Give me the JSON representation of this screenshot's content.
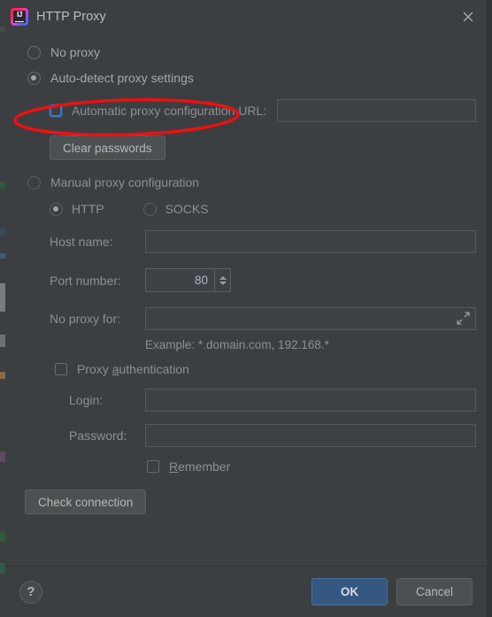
{
  "window": {
    "title": "HTTP Proxy",
    "app_icon": "intellij-idea-icon",
    "close_icon": "close-icon"
  },
  "proxy_mode": {
    "selected": "auto-detect",
    "options": [
      {
        "id": "no-proxy",
        "label": "No proxy",
        "checked": false
      },
      {
        "id": "auto-detect",
        "label": "Auto-detect proxy settings",
        "checked": true
      },
      {
        "id": "manual",
        "label": "Manual proxy configuration",
        "checked": false
      }
    ]
  },
  "auto_section": {
    "pac_checkbox_label": "Automatic proxy configuration URL:",
    "pac_checked": false,
    "pac_url_value": "",
    "clear_passwords_label": "Clear passwords"
  },
  "manual_section": {
    "protocol": {
      "selected": "HTTP",
      "options": [
        {
          "id": "http",
          "label": "HTTP",
          "checked": true
        },
        {
          "id": "socks",
          "label": "SOCKS",
          "checked": false
        }
      ]
    },
    "host_name_label": "Host name:",
    "host_name_value": "",
    "port_number_label": "Port number:",
    "port_number_value": "80",
    "no_proxy_for_label": "No proxy for:",
    "no_proxy_for_value": "",
    "expand_icon": "expand-arrows-icon",
    "example_text": "Example: *.domain.com, 192.168.*",
    "proxy_auth_label": "Proxy authentication",
    "proxy_auth_mnemonic": "a",
    "proxy_auth_checked": false,
    "login_label": "Login:",
    "login_value": "",
    "password_label": "Password:",
    "password_value": "",
    "remember_label": "Remember",
    "remember_mnemonic": "R",
    "remember_checked": false
  },
  "check_connection_label": "Check connection",
  "footer": {
    "help_icon": "question-mark-icon",
    "ok_label": "OK",
    "cancel_label": "Cancel"
  },
  "annotation": {
    "shape": "red-ellipse",
    "target": "Auto-detect proxy settings",
    "color": "#f30f10"
  },
  "colors": {
    "dialog_background": "#3c3f41",
    "primary_button": "#365880",
    "text": "#a6a6a6",
    "field_background": "#45494a",
    "focus_border": "#4477bb"
  }
}
